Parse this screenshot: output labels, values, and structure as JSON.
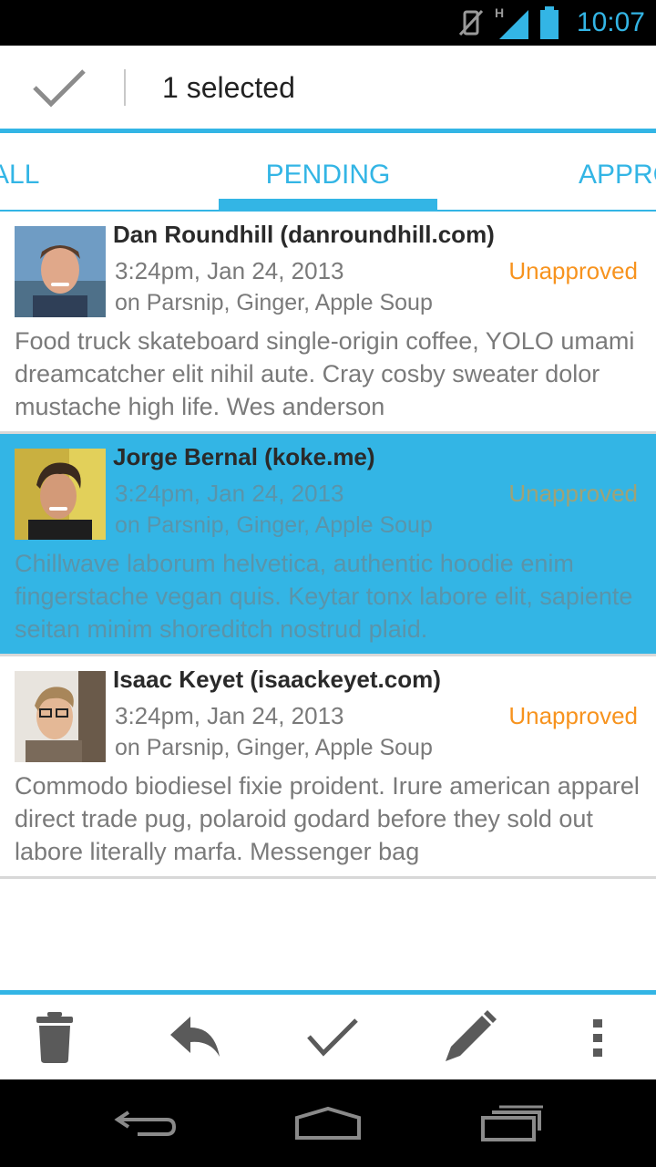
{
  "status_bar": {
    "time": "10:07",
    "network_label": "H",
    "icons": [
      "vibrate-off-icon",
      "signal-icon",
      "battery-icon"
    ]
  },
  "action_mode": {
    "title": "1 selected",
    "done_icon": "checkmark-icon"
  },
  "tabs": [
    {
      "label": "ALL",
      "active": false
    },
    {
      "label": "PENDING",
      "active": true
    },
    {
      "label": "APPROVED",
      "active": false
    }
  ],
  "comments": [
    {
      "author": "Dan Roundhill (danroundhill.com)",
      "date": "3:24pm, Jan 24, 2013",
      "post": "on Parsnip, Ginger, Apple Soup",
      "status": "Unapproved",
      "body": "Food truck skateboard single-origin coffee, YOLO umami dreamcatcher elit nihil aute. Cray cosby sweater dolor mustache high life. Wes anderson",
      "selected": false
    },
    {
      "author": "Jorge Bernal (koke.me)",
      "date": "3:24pm, Jan 24, 2013",
      "post": "on Parsnip, Ginger, Apple Soup",
      "status": "Unapproved",
      "body": "Chillwave laborum helvetica, authentic hoodie enim fingerstache vegan quis. Keytar tonx labore elit, sapiente seitan minim shoreditch nostrud plaid.",
      "selected": true
    },
    {
      "author": "Isaac Keyet (isaackeyet.com)",
      "date": "3:24pm, Jan 24, 2013",
      "post": "on Parsnip, Ginger, Apple Soup",
      "status": "Unapproved",
      "body": "Commodo biodiesel fixie proident. Irure american apparel direct trade pug, polaroid godard before they sold out labore literally marfa. Messenger bag",
      "selected": false
    }
  ],
  "bottom_actions": [
    "trash-icon",
    "reply-icon",
    "approve-check-icon",
    "edit-pencil-icon",
    "overflow-menu-icon"
  ],
  "nav_buttons": [
    "back-icon",
    "home-icon",
    "recents-icon"
  ],
  "colors": {
    "accent": "#33b5e5",
    "status_unapproved": "#f7931e",
    "selected_row": "#33b5e5"
  }
}
